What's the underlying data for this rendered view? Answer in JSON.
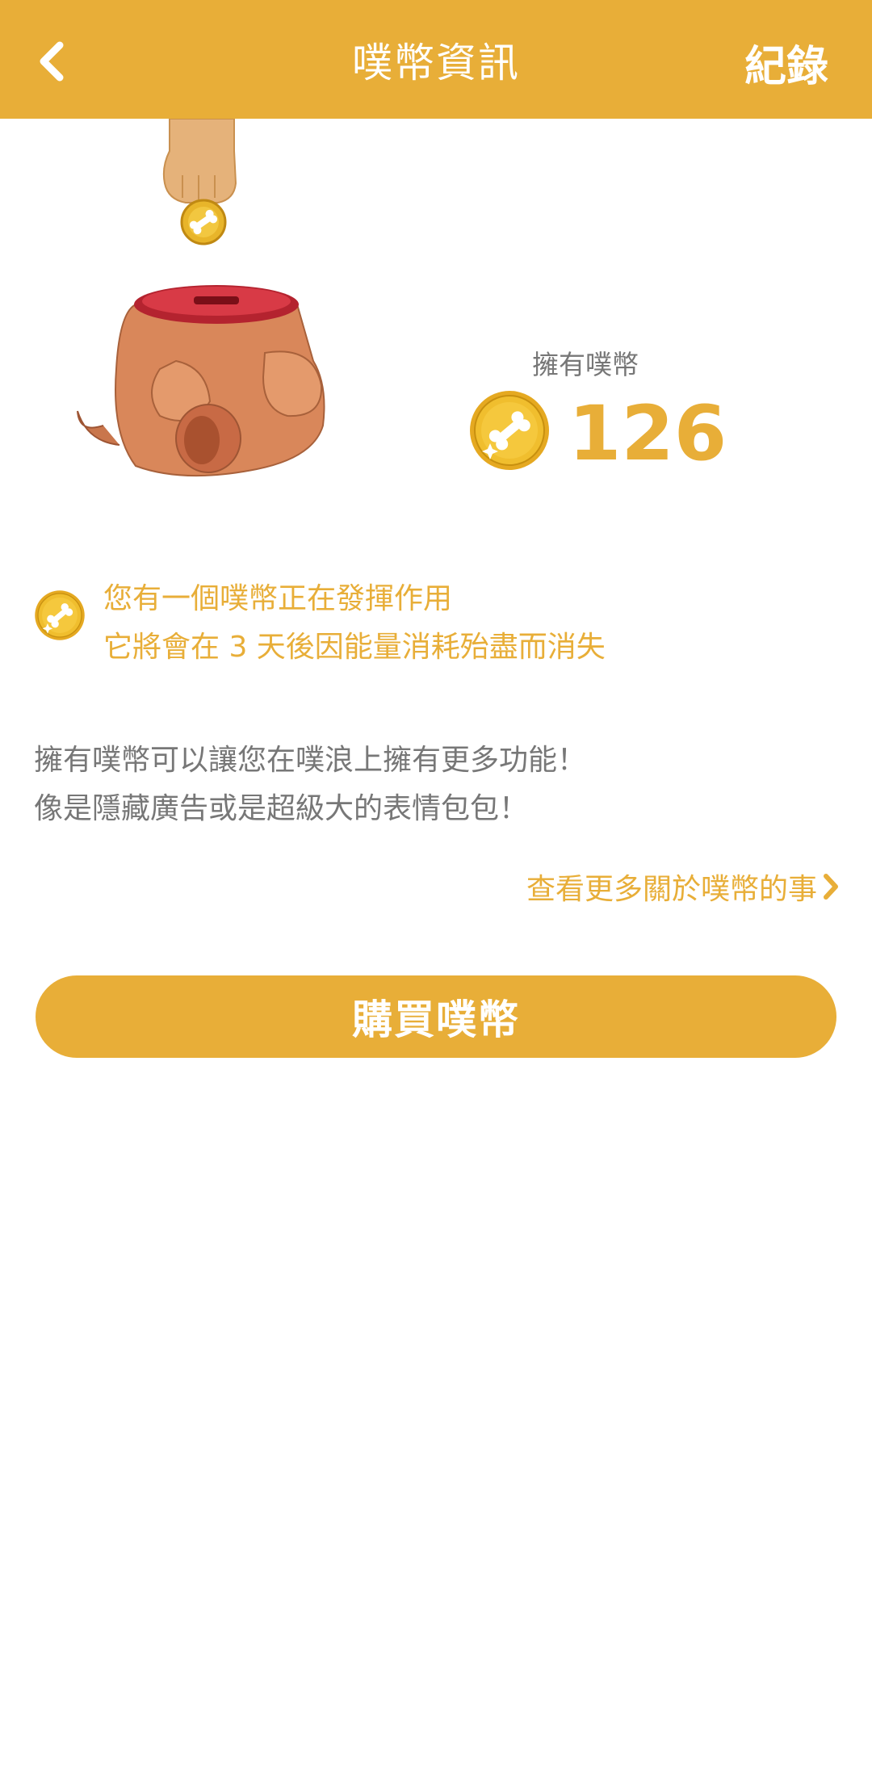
{
  "header": {
    "title": "噗幣資訊",
    "back_icon": "chevron-left-icon",
    "record_label": "紀錄"
  },
  "balance": {
    "label": "擁有噗幣",
    "value": "126",
    "coin_icon": "bone-coin-icon"
  },
  "notice": {
    "line1": "您有一個噗幣正在發揮作用",
    "line2": "它將會在 3 天後因能量消耗殆盡而消失",
    "coin_icon": "bone-coin-icon"
  },
  "description": {
    "line1": "擁有噗幣可以讓您在噗浪上擁有更多功能！",
    "line2": "像是隱藏廣告或是超級大的表情包包！"
  },
  "more_link": {
    "label": "查看更多關於噗幣的事",
    "icon": "chevron-right-icon"
  },
  "buy_button": {
    "label": "購買噗幣"
  },
  "colors": {
    "accent": "#E8AE38",
    "text_gray": "#777777",
    "background": "#FFFFFF"
  }
}
